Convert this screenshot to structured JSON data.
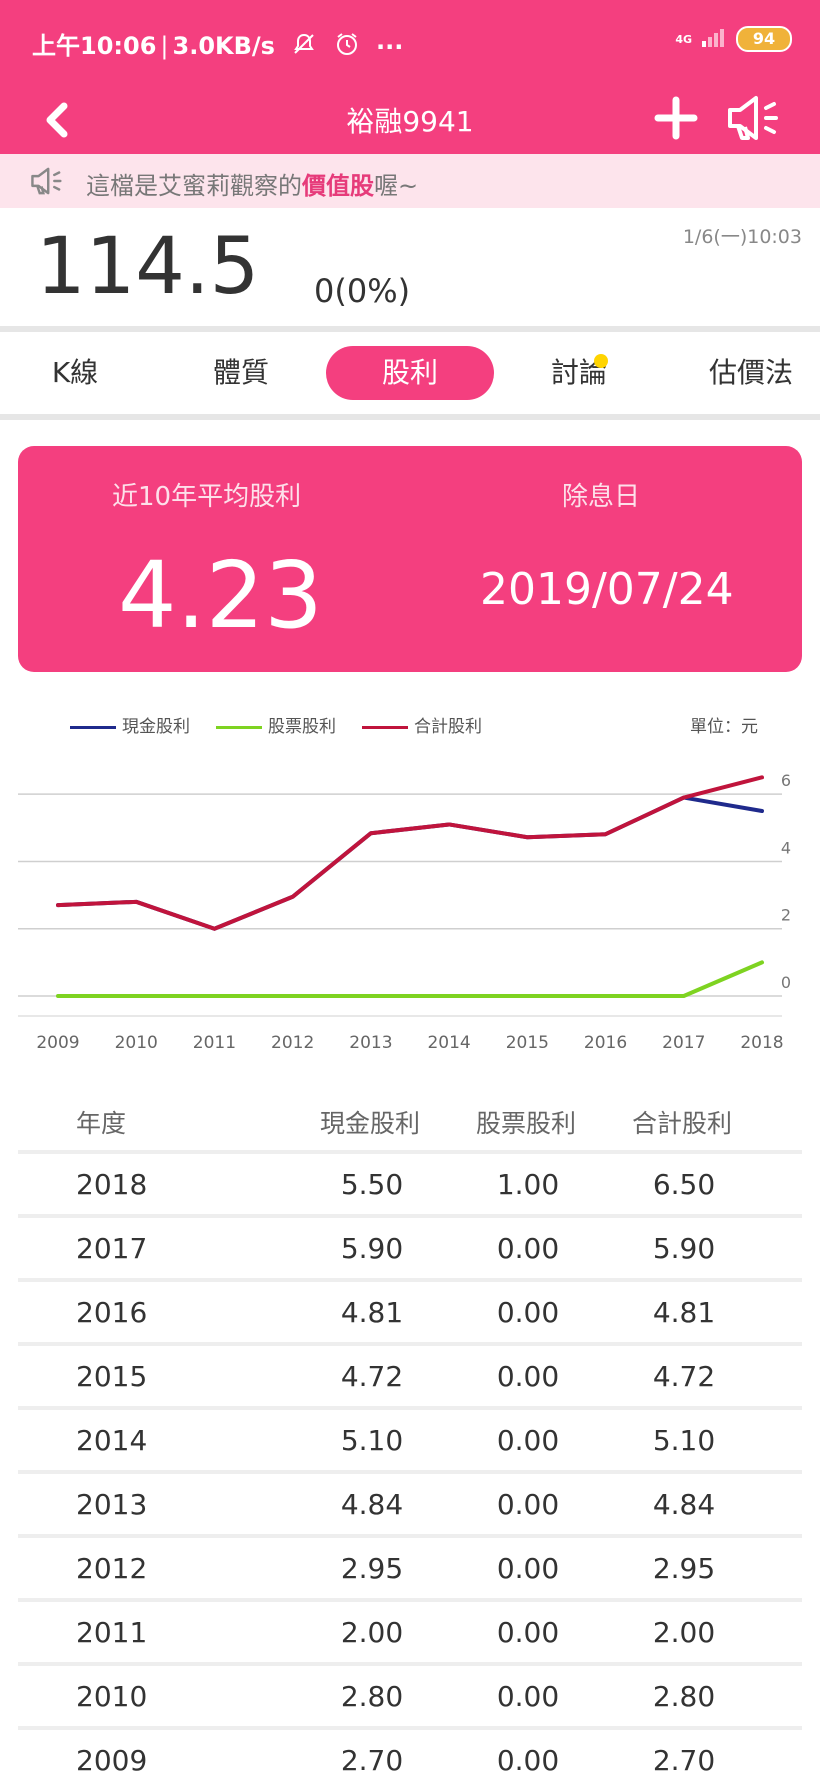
{
  "status_bar": {
    "time": "上午10:06",
    "net_speed": "3.0KB/s",
    "more": "···",
    "signal_label": "4G",
    "battery": "94"
  },
  "header": {
    "title": "裕融9941",
    "icons": [
      "back-icon",
      "plus-icon",
      "speaker-icon"
    ]
  },
  "announcement": {
    "prefix": "這檔是艾蜜莉觀察的",
    "highlight": "價值股",
    "suffix": "喔~"
  },
  "quote": {
    "price": "114.5",
    "change": "0(0%)",
    "timestamp": "1/6(一)10:03"
  },
  "tabs": [
    {
      "label": "K線",
      "active": false
    },
    {
      "label": "體質",
      "active": false
    },
    {
      "label": "股利",
      "active": true
    },
    {
      "label": "討論",
      "active": false,
      "badge": true
    },
    {
      "label": "估價法",
      "active": false
    }
  ],
  "summary": {
    "avg_label": "近10年平均股利",
    "avg_value": "4.23",
    "exdiv_label": "除息日",
    "exdiv_value": "2019/07/24"
  },
  "chart_data": {
    "type": "line",
    "x": [
      "2009",
      "2010",
      "2011",
      "2012",
      "2013",
      "2014",
      "2015",
      "2016",
      "2017",
      "2018"
    ],
    "series": [
      {
        "name": "現金股利",
        "color": "#1f2a8c",
        "values": [
          2.7,
          2.8,
          2.0,
          2.95,
          4.84,
          5.1,
          4.72,
          4.81,
          5.9,
          5.5
        ]
      },
      {
        "name": "股票股利",
        "color": "#7ed321",
        "values": [
          0.0,
          0.0,
          0.0,
          0.0,
          0.0,
          0.0,
          0.0,
          0.0,
          0.0,
          1.0
        ]
      },
      {
        "name": "合計股利",
        "color": "#c0143c",
        "values": [
          2.7,
          2.8,
          2.0,
          2.95,
          4.84,
          5.1,
          4.72,
          4.81,
          5.9,
          6.5
        ]
      }
    ],
    "unit_label": "單位：元",
    "y_ticks": [
      "0",
      "2",
      "4",
      "6"
    ],
    "ylim": [
      0,
      6.6
    ],
    "grid": true,
    "legend_position": "top"
  },
  "table": {
    "headers": [
      "年度",
      "現金股利",
      "股票股利",
      "合計股利"
    ],
    "rows": [
      {
        "year": "2018",
        "cash": "5.50",
        "stock": "1.00",
        "total": "6.50"
      },
      {
        "year": "2017",
        "cash": "5.90",
        "stock": "0.00",
        "total": "5.90"
      },
      {
        "year": "2016",
        "cash": "4.81",
        "stock": "0.00",
        "total": "4.81"
      },
      {
        "year": "2015",
        "cash": "4.72",
        "stock": "0.00",
        "total": "4.72"
      },
      {
        "year": "2014",
        "cash": "5.10",
        "stock": "0.00",
        "total": "5.10"
      },
      {
        "year": "2013",
        "cash": "4.84",
        "stock": "0.00",
        "total": "4.84"
      },
      {
        "year": "2012",
        "cash": "2.95",
        "stock": "0.00",
        "total": "2.95"
      },
      {
        "year": "2011",
        "cash": "2.00",
        "stock": "0.00",
        "total": "2.00"
      },
      {
        "year": "2010",
        "cash": "2.80",
        "stock": "0.00",
        "total": "2.80"
      },
      {
        "year": "2009",
        "cash": "2.70",
        "stock": "0.00",
        "total": "2.70"
      }
    ]
  },
  "colors": {
    "accent": "#f43f7f",
    "accent_light": "#fde4ec",
    "highlight_text": "#e63b7a",
    "badge": "#ffd400"
  }
}
